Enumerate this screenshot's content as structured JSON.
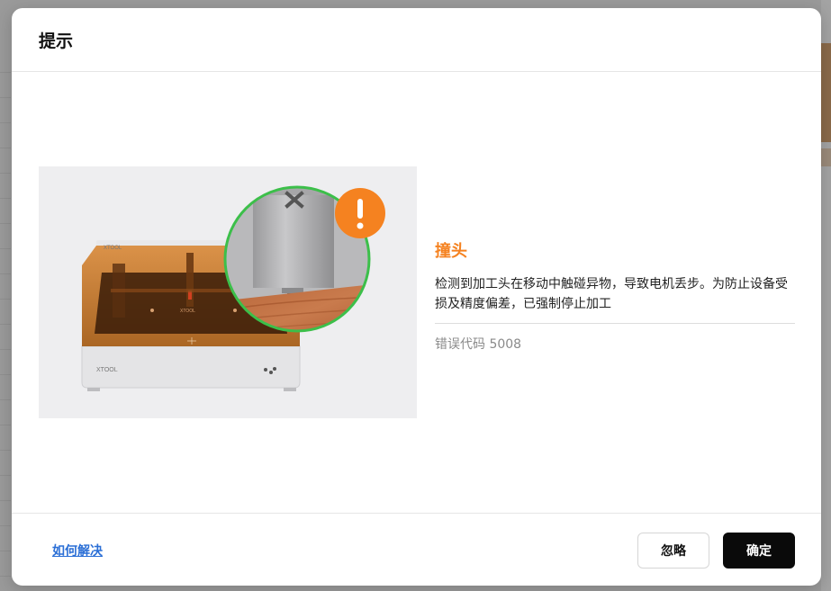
{
  "dialog": {
    "title": "提示"
  },
  "illustration": {
    "brand_text": "xTOOL",
    "warning_symbol": "!",
    "head_logo": "X"
  },
  "message": {
    "title": "撞头",
    "description": "检测到加工头在移动中触碰异物，导致电机丢步。为防止设备受损及精度偏差，已强制停止加工",
    "error_code": "错误代码 5008"
  },
  "footer": {
    "help_link": "如何解决",
    "ignore_label": "忽略",
    "confirm_label": "确定"
  },
  "colors": {
    "accent_orange": "#f58220",
    "link_blue": "#2b6fd6",
    "confirm_bg": "#0a0a0a",
    "zoom_ring_green": "#3cbf4a"
  },
  "icons": [
    "warning-icon"
  ]
}
